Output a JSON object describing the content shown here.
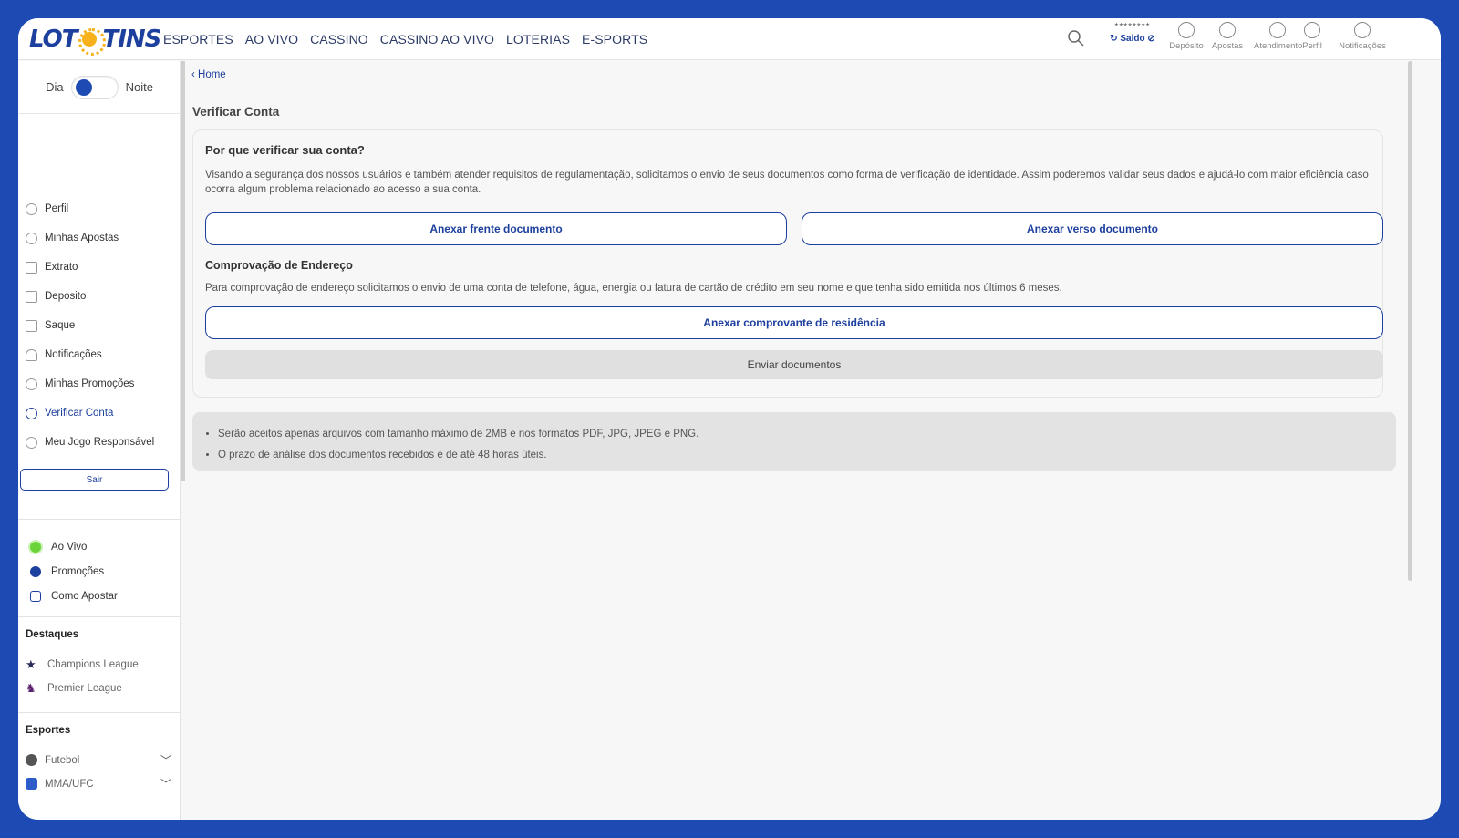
{
  "header": {
    "logo_left": "LOT",
    "logo_right": "TINS",
    "nav": [
      "ESPORTES",
      "AO VIVO",
      "CASSINO",
      "CASSINO AO VIVO",
      "LOTERIAS",
      "E-SPORTS"
    ],
    "balance_hidden": "********",
    "balance_label": "Saldo",
    "icons": {
      "deposito": "Depósito",
      "apostas": "Apostas",
      "atendimento": "Atendimento",
      "perfil": "Perfil",
      "notificacoes": "Notificações"
    }
  },
  "theme_toggle": {
    "day": "Dia",
    "night": "Noite"
  },
  "sidebar": {
    "items": [
      {
        "label": "Perfil",
        "icon": "user-icon"
      },
      {
        "label": "Minhas Apostas",
        "icon": "bets-icon"
      },
      {
        "label": "Extrato",
        "icon": "statement-icon"
      },
      {
        "label": "Deposito",
        "icon": "deposit-icon"
      },
      {
        "label": "Saque",
        "icon": "withdraw-icon"
      },
      {
        "label": "Notificações",
        "icon": "bell-icon"
      },
      {
        "label": "Minhas Promoções",
        "icon": "tag-icon"
      },
      {
        "label": "Verificar Conta",
        "icon": "shield-icon"
      },
      {
        "label": "Meu Jogo Responsável",
        "icon": "responsible-game-icon"
      }
    ],
    "logout": "Sair",
    "quick": [
      "Ao Vivo",
      "Promoções",
      "Como Apostar"
    ],
    "highlights_title": "Destaques",
    "highlights": [
      "Champions League",
      "Premier League"
    ],
    "sports_title": "Esportes",
    "sports": [
      "Futebol",
      "MMA/UFC"
    ]
  },
  "main": {
    "breadcrumb": "Home",
    "title": "Verificar Conta",
    "why_title": "Por que verificar sua conta?",
    "why_text": "Visando a segurança dos nossos usuários e também atender requisitos de regulamentação, solicitamos o envio de seus documentos como forma de verificação de identidade. Assim poderemos validar seus dados e ajudá-lo com maior eficiência caso ocorra algum problema relacionado ao acesso a sua conta.",
    "btn_front": "Anexar frente documento",
    "btn_back": "Anexar verso documento",
    "address_title": "Comprovação de Endereço",
    "address_text": "Para comprovação de endereço solicitamos o envio de uma conta de telefone, água, energia ou fatura de cartão de crédito em seu nome e que tenha sido emitida nos últimos 6 meses.",
    "btn_address": "Anexar comprovante de residência",
    "btn_send": "Enviar documentos",
    "notes": [
      "Serão aceitos apenas arquivos com tamanho máximo de 2MB e nos formatos PDF, JPG, JPEG e PNG.",
      "O prazo de análise dos documentos recebidos é de até 48 horas úteis."
    ]
  },
  "colors": {
    "brand": "#1e4bb3",
    "accent": "#1d3f9e",
    "logo_sun": "#f7b21b",
    "live": "#6ad43a"
  }
}
